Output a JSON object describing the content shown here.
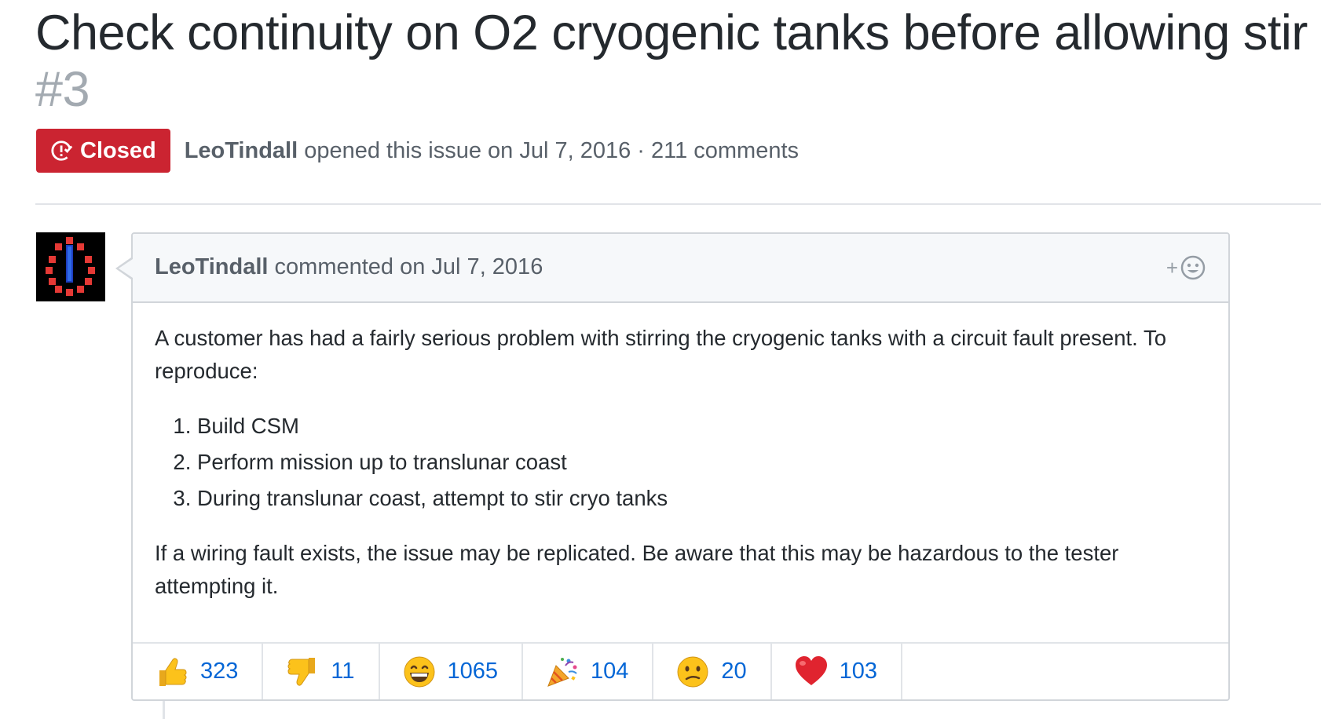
{
  "issue": {
    "title": "Check continuity on O2 cryogenic tanks before allowing stir",
    "number": "#3",
    "state": "Closed",
    "state_icon": "issue-closed-icon",
    "author": "LeoTindall",
    "opened_text": "opened this issue on Jul 7, 2016 · 211 comments",
    "colors": {
      "closed": "#cb2431",
      "link": "#0366d6"
    }
  },
  "comment": {
    "author": "LeoTindall",
    "action": "commented on Jul 7, 2016",
    "add_reaction_label": "+",
    "add_reaction_icon": "smiley-icon",
    "paragraph1": "A customer has had a fairly serious problem with stirring the cryogenic tanks with a circuit fault present. To reproduce:",
    "steps": [
      "Build CSM",
      "Perform mission up to translunar coast",
      "During translunar coast, attempt to stir cryo tanks"
    ],
    "paragraph2": "If a wiring fault exists, the issue may be replicated. Be aware that this may be hazardous to the tester attempting it."
  },
  "reactions": [
    {
      "icon": "thumbs-up-icon",
      "count": "323"
    },
    {
      "icon": "thumbs-down-icon",
      "count": "11"
    },
    {
      "icon": "laugh-icon",
      "count": "1065"
    },
    {
      "icon": "hooray-icon",
      "count": "104"
    },
    {
      "icon": "confused-icon",
      "count": "20"
    },
    {
      "icon": "heart-icon",
      "count": "103"
    }
  ]
}
